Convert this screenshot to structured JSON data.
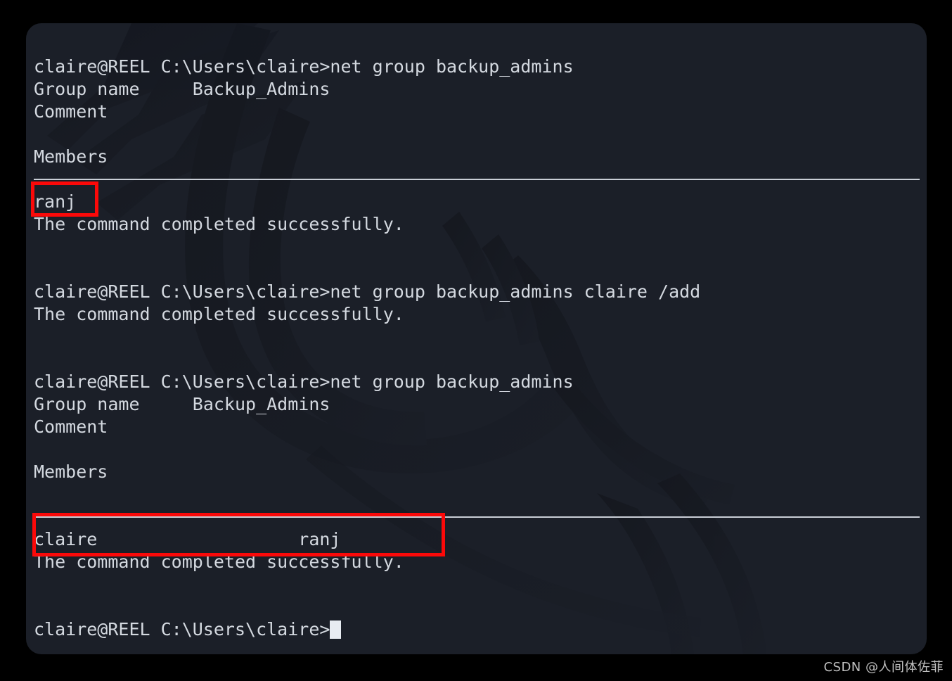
{
  "window": {
    "title": "claire@REEL",
    "background_color": "#1b1f28",
    "text_color": "#d4d9e0",
    "accent_color": "#fb0909",
    "page_background": "#000000"
  },
  "terminal": {
    "lines": [
      {
        "id": "l0",
        "text": "claire@REEL C:\\Users\\claire>net group backup_admins",
        "kind": "prompt"
      },
      {
        "id": "l1",
        "text": "Group name     Backup_Admins",
        "kind": "output"
      },
      {
        "id": "l2",
        "text": "Comment",
        "kind": "output"
      },
      {
        "id": "l3",
        "text": "",
        "kind": "blank"
      },
      {
        "id": "l4",
        "text": "Members",
        "kind": "output"
      },
      {
        "id": "l5",
        "text": "",
        "kind": "blank"
      },
      {
        "id": "l6",
        "text": "__SEPARATOR__",
        "kind": "separator"
      },
      {
        "id": "l7",
        "text": "ranj",
        "kind": "output"
      },
      {
        "id": "l8",
        "text": "The command completed successfully.",
        "kind": "output"
      },
      {
        "id": "l9",
        "text": "",
        "kind": "blank"
      },
      {
        "id": "l10",
        "text": "",
        "kind": "blank"
      },
      {
        "id": "l11",
        "text": "claire@REEL C:\\Users\\claire>net group backup_admins claire /add",
        "kind": "prompt"
      },
      {
        "id": "l12",
        "text": "The command completed successfully.",
        "kind": "output"
      },
      {
        "id": "l13",
        "text": "",
        "kind": "blank"
      },
      {
        "id": "l14",
        "text": "",
        "kind": "blank"
      },
      {
        "id": "l15",
        "text": "claire@REEL C:\\Users\\claire>net group backup_admins",
        "kind": "prompt"
      },
      {
        "id": "l16",
        "text": "Group name     Backup_Admins",
        "kind": "output"
      },
      {
        "id": "l17",
        "text": "Comment",
        "kind": "output"
      },
      {
        "id": "l18",
        "text": "",
        "kind": "blank"
      },
      {
        "id": "l19",
        "text": "Members",
        "kind": "output"
      },
      {
        "id": "l20",
        "text": "",
        "kind": "blank"
      },
      {
        "id": "l21",
        "text": "__SEPARATOR__",
        "kind": "separator"
      },
      {
        "id": "l22",
        "text": "claire                   ranj",
        "kind": "output"
      },
      {
        "id": "l23",
        "text": "The command completed successfully.",
        "kind": "output"
      },
      {
        "id": "l24",
        "text": "",
        "kind": "blank"
      },
      {
        "id": "l25",
        "text": "",
        "kind": "blank"
      },
      {
        "id": "l26",
        "text": "claire@REEL C:\\Users\\claire>",
        "kind": "prompt-cursor"
      }
    ],
    "prompt_text": "claire@REEL C:\\Users\\claire>",
    "commands": [
      "net group backup_admins",
      "net group backup_admins claire /add",
      "net group backup_admins"
    ],
    "group_name_label": "Group name",
    "group_name_value": "Backup_Admins",
    "comment_label": "Comment",
    "members_label": "Members",
    "members_before": [
      "ranj"
    ],
    "members_after": [
      "claire",
      "ranj"
    ],
    "success_message": "The command completed successfully."
  },
  "annotations": [
    {
      "id": "box-ranj",
      "label": "ranj"
    },
    {
      "id": "box-claire",
      "label": "claire                   ranj"
    }
  ],
  "watermark": {
    "text": "CSDN @人间体佐菲"
  }
}
